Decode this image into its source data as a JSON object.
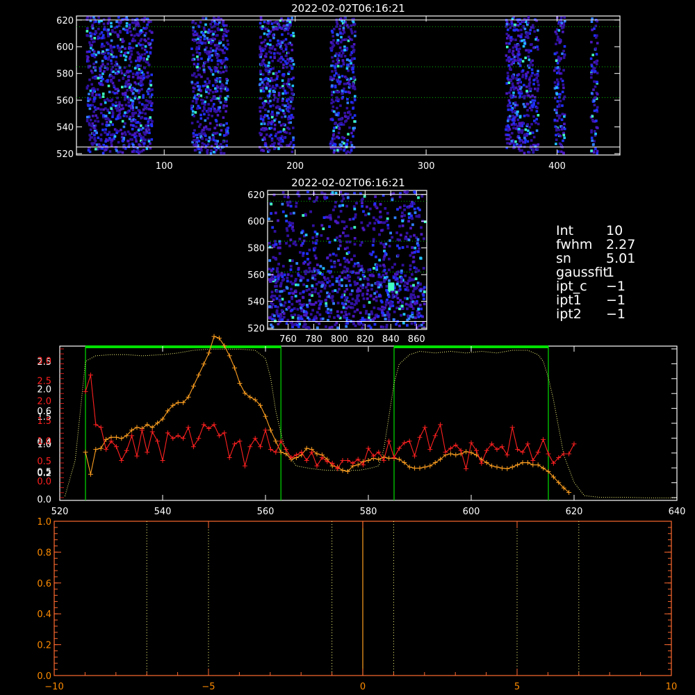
{
  "colors": {
    "background": "#000000",
    "axis": "#ffffff",
    "green": "#00e000",
    "red": "#ff2020",
    "orange": "#ffa020",
    "yellow_dotted": "#ffff80",
    "bottom_axis": "#ff6a30",
    "bottom_ticklabel": "#ff8c00",
    "heat_low": "#3010a0",
    "heat_mid": "#2030ff",
    "heat_high": "#40ffc0"
  },
  "top_image": {
    "title": "2022-02-02T06:16:21",
    "xticks": [
      "100",
      "200",
      "300",
      "400"
    ],
    "yticks": [
      "520",
      "540",
      "560",
      "580",
      "600",
      "620"
    ]
  },
  "mid_image": {
    "title": "2022-02-02T06:16:21",
    "xticks": [
      "760",
      "780",
      "800",
      "820",
      "840",
      "860"
    ],
    "yticks": [
      "520",
      "540",
      "560",
      "580",
      "600",
      "620"
    ]
  },
  "info": {
    "rows": [
      {
        "key": "Int",
        "value": "10"
      },
      {
        "key": "fwhm",
        "value": "2.27"
      },
      {
        "key": "sn",
        "value": "5.01"
      },
      {
        "key": "gaussfit",
        "value": "1"
      },
      {
        "key": "ipt_c",
        "value": "−1"
      },
      {
        "key": "ipt1",
        "value": "−1"
      },
      {
        "key": "ipt2",
        "value": "−1"
      }
    ]
  },
  "chart_data": [
    {
      "type": "heatmap",
      "title": "2022-02-02T06:16:21",
      "xlim": [
        33,
        448
      ],
      "ylim": [
        519,
        623
      ],
      "xticks": [
        100,
        200,
        300,
        400
      ],
      "yticks": [
        520,
        540,
        560,
        580,
        600,
        620
      ],
      "hlines": [
        525,
        562,
        585,
        615,
        620
      ],
      "active_column_bands": [
        [
          40,
          90
        ],
        [
          120,
          148
        ],
        [
          172,
          198
        ],
        [
          226,
          245
        ],
        [
          360,
          385
        ],
        [
          397,
          405
        ],
        [
          425,
          430
        ]
      ]
    },
    {
      "type": "heatmap",
      "title": "2022-02-02T06:16:21",
      "xlim": [
        744,
        868
      ],
      "ylim": [
        519,
        623
      ],
      "xticks": [
        760,
        780,
        800,
        820,
        840,
        860
      ],
      "yticks": [
        520,
        540,
        560,
        580,
        600,
        620
      ],
      "hlines": [
        525,
        562,
        585,
        615,
        620
      ],
      "hotspot": [
        840,
        551
      ]
    },
    {
      "type": "line",
      "xlim": [
        520,
        640
      ],
      "xticks": [
        520,
        540,
        560,
        580,
        600,
        620,
        640
      ],
      "yticks_white": [
        "0.0",
        "0.5",
        "1.0",
        "1.5",
        "2.0",
        "2.5"
      ],
      "yticks_white_values": [
        0,
        0.5,
        1.0,
        1.5,
        2.0,
        2.5
      ],
      "yticks_left_extra": [
        {
          "label": "0.2",
          "color": "white",
          "frac": 0.181
        },
        {
          "label": "0.4",
          "color": "white",
          "frac": 0.381
        },
        {
          "label": "0.6",
          "color": "white",
          "frac": 0.581
        },
        {
          "label": "2.5",
          "color": "red",
          "frac": 0.777
        },
        {
          "label": "2.0",
          "color": "red",
          "frac": 0.647
        },
        {
          "label": "1.5",
          "color": "red",
          "frac": 0.517
        },
        {
          "label": "1.0",
          "color": "red",
          "frac": 0.387
        },
        {
          "label": "0.5",
          "color": "red",
          "frac": 0.257
        },
        {
          "label": "0.0",
          "color": "red",
          "frac": 0.127
        },
        {
          "label": "3.0",
          "color": "red",
          "frac": 0.907
        }
      ],
      "windows": [
        [
          525,
          563
        ],
        [
          585,
          615
        ]
      ],
      "series": [
        {
          "color": "yellow_dotted",
          "x": [
            521,
            523,
            525,
            527,
            530,
            533,
            536,
            540,
            543,
            546,
            549,
            552,
            555,
            558,
            560,
            561,
            562,
            563,
            564,
            566,
            569,
            572,
            575,
            578,
            580,
            582,
            583,
            584,
            585,
            586,
            588,
            590,
            593,
            596,
            599,
            602,
            605,
            608,
            611,
            613,
            614,
            615,
            616,
            617,
            618,
            620,
            622,
            625,
            630,
            635,
            640
          ],
          "y": [
            0.05,
            0.7,
            2.5,
            2.6,
            2.62,
            2.62,
            2.6,
            2.62,
            2.65,
            2.7,
            2.72,
            2.72,
            2.72,
            2.7,
            2.55,
            2.2,
            1.6,
            1.2,
            0.85,
            0.6,
            0.55,
            0.52,
            0.52,
            0.52,
            0.55,
            0.6,
            0.9,
            1.5,
            2.1,
            2.45,
            2.62,
            2.68,
            2.65,
            2.68,
            2.65,
            2.68,
            2.65,
            2.7,
            2.7,
            2.62,
            2.5,
            2.2,
            1.8,
            1.3,
            0.8,
            0.3,
            0.06,
            0.03,
            0.03,
            0.02,
            0.02
          ]
        },
        {
          "color": "orange",
          "x": [
            525,
            526,
            527,
            528,
            529,
            530,
            531,
            532,
            533,
            534,
            535,
            536,
            537,
            538,
            539,
            540,
            541,
            542,
            543,
            544,
            545,
            546,
            547,
            548,
            549,
            550,
            551,
            552,
            553,
            554,
            555,
            556,
            557,
            558,
            559,
            560,
            561,
            562,
            563,
            564,
            565,
            566,
            567,
            568,
            569,
            570,
            571,
            572,
            573,
            574,
            575,
            576,
            577,
            578,
            579,
            580,
            581,
            582,
            583,
            584,
            585,
            586,
            587,
            588,
            589,
            590,
            591,
            592,
            593,
            594,
            595,
            596,
            597,
            598,
            599,
            600,
            601,
            602,
            603,
            604,
            605,
            606,
            607,
            608,
            609,
            610,
            611,
            612,
            613,
            614,
            615,
            616,
            617,
            618,
            619
          ],
          "y": [
            0.85,
            0.45,
            0.9,
            0.92,
            1.08,
            1.12,
            1.12,
            1.1,
            1.15,
            1.25,
            1.3,
            1.28,
            1.35,
            1.3,
            1.38,
            1.45,
            1.6,
            1.7,
            1.75,
            1.75,
            1.85,
            2.05,
            2.25,
            2.45,
            2.65,
            2.95,
            2.92,
            2.78,
            2.6,
            2.38,
            2.1,
            1.92,
            1.85,
            1.8,
            1.7,
            1.5,
            1.25,
            1.05,
            0.85,
            0.82,
            0.72,
            0.75,
            0.8,
            0.92,
            0.9,
            0.82,
            0.8,
            0.72,
            0.6,
            0.58,
            0.52,
            0.5,
            0.6,
            0.62,
            0.68,
            0.7,
            0.74,
            0.72,
            0.76,
            0.74,
            0.74,
            0.72,
            0.66,
            0.58,
            0.56,
            0.56,
            0.58,
            0.6,
            0.66,
            0.72,
            0.8,
            0.82,
            0.8,
            0.82,
            0.86,
            0.84,
            0.8,
            0.72,
            0.66,
            0.6,
            0.58,
            0.56,
            0.55,
            0.58,
            0.62,
            0.66,
            0.66,
            0.62,
            0.62,
            0.56,
            0.5,
            0.4,
            0.3,
            0.2,
            0.12
          ]
        },
        {
          "color": "red",
          "x": [
            525,
            526,
            527,
            528,
            529,
            530,
            531,
            532,
            533,
            534,
            535,
            536,
            537,
            538,
            539,
            540,
            541,
            542,
            543,
            544,
            545,
            546,
            547,
            548,
            549,
            550,
            551,
            552,
            553,
            554,
            555,
            556,
            557,
            558,
            559,
            560,
            561,
            562,
            563,
            564,
            565,
            566,
            567,
            568,
            569,
            570,
            571,
            572,
            573,
            574,
            575,
            576,
            577,
            578,
            579,
            580,
            581,
            582,
            583,
            584,
            585,
            586,
            587,
            588,
            589,
            590,
            591,
            592,
            593,
            594,
            595,
            596,
            597,
            598,
            599,
            600,
            601,
            602,
            603,
            604,
            605,
            606,
            607,
            608,
            609,
            610,
            611,
            612,
            613,
            614,
            615,
            616,
            617,
            618,
            619,
            620
          ],
          "y": [
            1.95,
            2.25,
            1.35,
            1.3,
            0.9,
            1.05,
            0.95,
            0.7,
            0.88,
            1.15,
            0.78,
            1.25,
            0.85,
            1.22,
            1.05,
            0.7,
            1.2,
            1.1,
            1.15,
            1.1,
            1.3,
            0.95,
            1.1,
            1.35,
            1.28,
            1.35,
            1.15,
            1.2,
            0.75,
            1.0,
            1.05,
            0.6,
            0.95,
            1.1,
            0.95,
            1.25,
            0.9,
            0.85,
            1.05,
            0.9,
            0.75,
            0.8,
            0.85,
            0.7,
            0.85,
            0.6,
            0.75,
            0.68,
            0.65,
            0.55,
            0.7,
            0.7,
            0.65,
            0.72,
            0.62,
            0.92,
            0.78,
            0.85,
            0.7,
            1.05,
            0.75,
            0.92,
            1.02,
            1.05,
            0.78,
            1.12,
            1.3,
            0.9,
            1.15,
            1.35,
            0.85,
            0.92,
            0.98,
            0.88,
            0.55,
            1.02,
            0.88,
            0.65,
            0.88,
            1.0,
            0.9,
            0.95,
            0.8,
            1.3,
            0.9,
            0.85,
            1.0,
            0.7,
            0.85,
            1.08,
            0.82,
            0.65,
            0.75,
            0.82,
            0.82,
            1.0
          ]
        }
      ]
    },
    {
      "type": "line",
      "xlim": [
        -10,
        10
      ],
      "ylim": [
        0,
        1
      ],
      "xticks": [
        "−10",
        "−5",
        "0",
        "5",
        "10"
      ],
      "xtick_values": [
        -10,
        -5,
        0,
        5,
        10
      ],
      "yticks": [
        "0.0",
        "0.2",
        "0.4",
        "0.6",
        "0.8",
        "1.0"
      ],
      "yticks_values": [
        0,
        0.2,
        0.4,
        0.6,
        0.8,
        1.0
      ],
      "vlines_dotted": [
        -7,
        -5,
        -1,
        1,
        5,
        7
      ],
      "vline_solid": 0
    }
  ]
}
